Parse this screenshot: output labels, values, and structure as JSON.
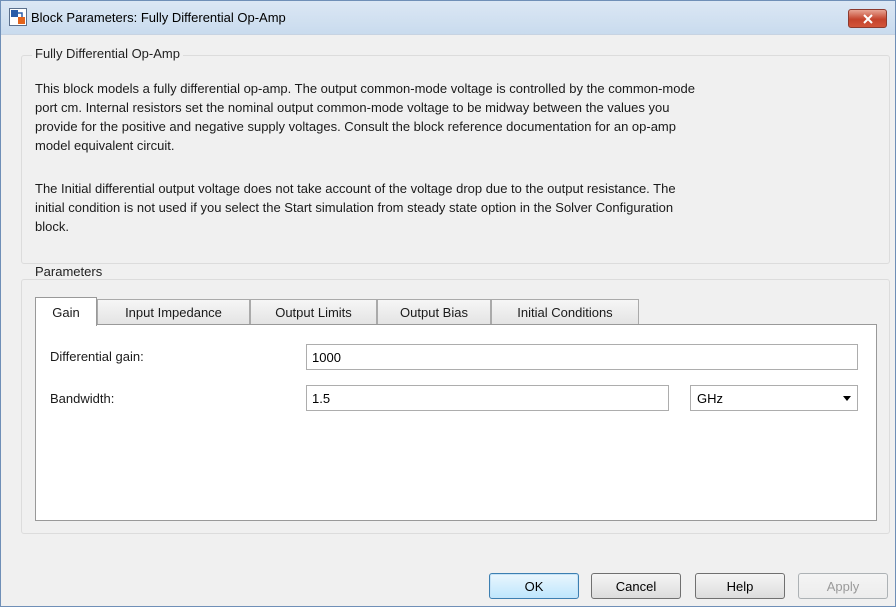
{
  "window": {
    "title": "Block Parameters: Fully Differential Op-Amp"
  },
  "block_group": {
    "legend": "Fully Differential Op-Amp",
    "description_1": [
      "This block models a fully differential op-amp. The output common-mode voltage is controlled by the common-mode",
      "port cm. Internal resistors set the nominal output common-mode voltage to be midway between the values you",
      "provide for the positive and negative supply voltages. Consult the block reference documentation for an op-amp",
      "model equivalent circuit."
    ],
    "description_2": [
      "The Initial differential output voltage does not take account of the voltage drop due to the output resistance. The",
      "initial condition is not used if you select the Start simulation from steady state option in the Solver Configuration",
      "block."
    ]
  },
  "parameters": {
    "legend": "Parameters",
    "tabs": [
      {
        "label": "Gain",
        "active": true
      },
      {
        "label": "Input Impedance"
      },
      {
        "label": "Output Limits"
      },
      {
        "label": "Output Bias"
      },
      {
        "label": "Initial Conditions"
      }
    ],
    "fields": {
      "differential_gain": {
        "label": "Differential gain:",
        "value": "1000"
      },
      "bandwidth": {
        "label": "Bandwidth:",
        "value": "1.5",
        "unit": "GHz"
      }
    }
  },
  "buttons": {
    "ok": "OK",
    "cancel": "Cancel",
    "help": "Help",
    "apply": "Apply"
  },
  "colors": {
    "titlebar": "#c9dbee",
    "close_button": "#c4432c",
    "default_button": "#bee6fd"
  },
  "icons": {
    "app": "simulink-block-icon",
    "close": "close-icon",
    "dropdown": "chevron-down-icon"
  }
}
